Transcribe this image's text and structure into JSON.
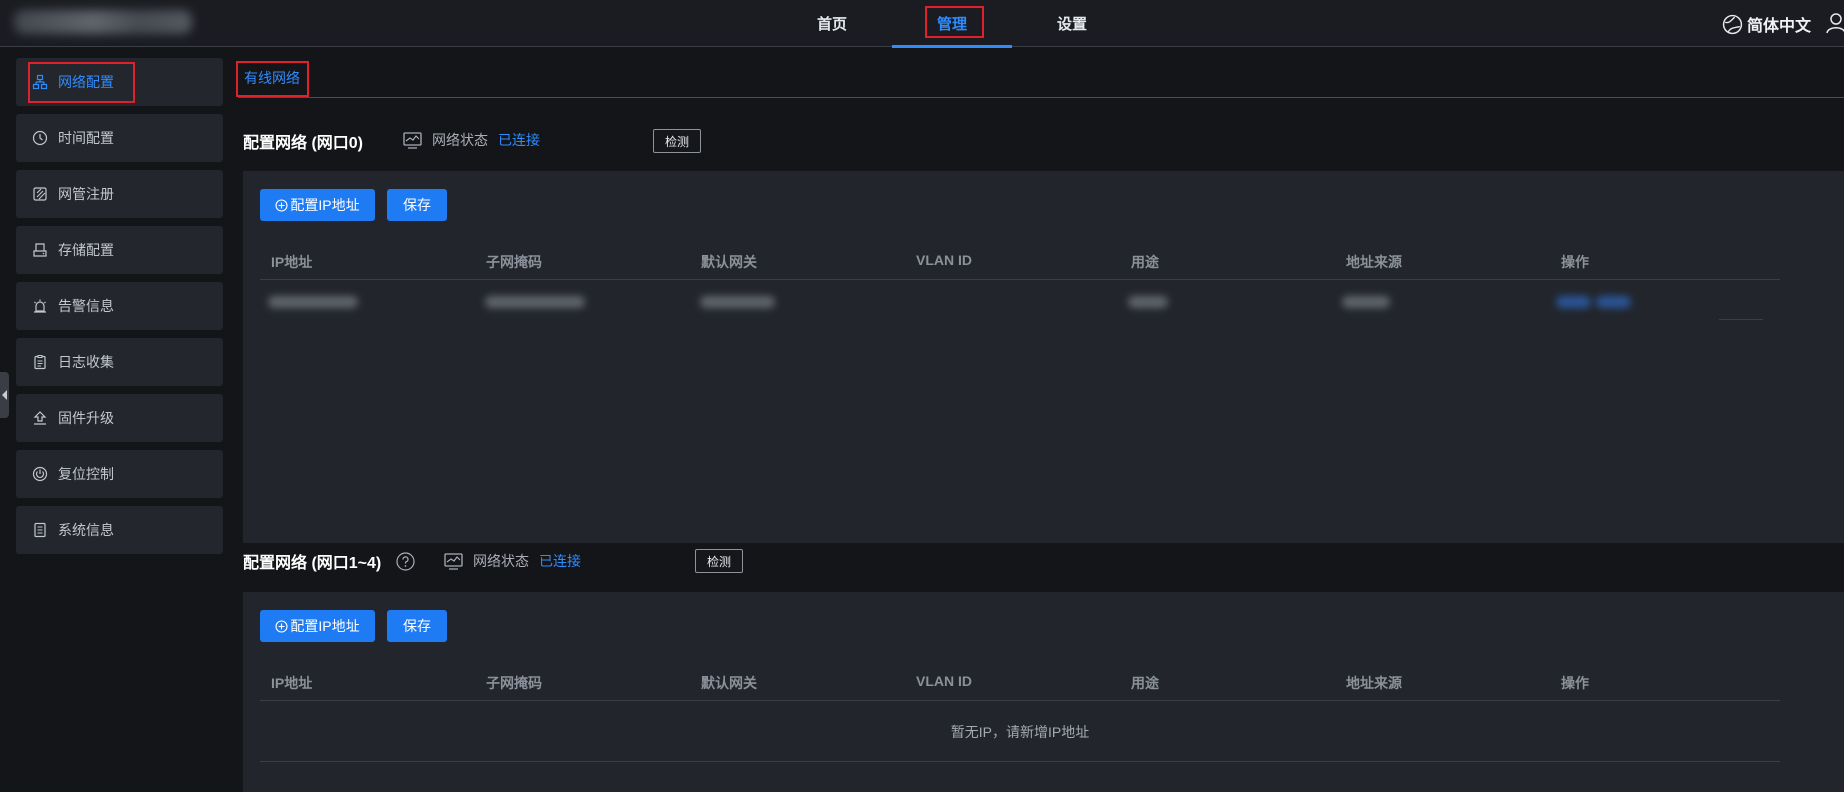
{
  "nav": {
    "home": "首页",
    "manage": "管理",
    "settings": "设置",
    "language": "简体中文"
  },
  "sidebar": {
    "items": [
      {
        "label": "网络配置",
        "icon": "network-icon",
        "active": true
      },
      {
        "label": "时间配置",
        "icon": "clock-icon"
      },
      {
        "label": "网管注册",
        "icon": "register-icon"
      },
      {
        "label": "存储配置",
        "icon": "storage-icon"
      },
      {
        "label": "告警信息",
        "icon": "alarm-icon"
      },
      {
        "label": "日志收集",
        "icon": "clipboard-icon"
      },
      {
        "label": "固件升级",
        "icon": "upgrade-icon"
      },
      {
        "label": "复位控制",
        "icon": "power-icon"
      },
      {
        "label": "系统信息",
        "icon": "document-icon"
      }
    ]
  },
  "tabs": {
    "wired": "有线网络"
  },
  "section0": {
    "title": "配置网络 (网口0)",
    "status_label": "网络状态",
    "status_value": "已连接",
    "detect": "检测",
    "add_ip": "配置IP地址",
    "save": "保存"
  },
  "section1": {
    "title": "配置网络 (网口1~4)",
    "status_label": "网络状态",
    "status_value": "已连接",
    "detect": "检测",
    "add_ip": "配置IP地址",
    "save": "保存",
    "empty": "暂无IP，请新增IP地址"
  },
  "table": {
    "columns": [
      "IP地址",
      "子网掩码",
      "默认网关",
      "VLAN ID",
      "用途",
      "地址来源",
      "操作"
    ]
  },
  "colors": {
    "accent": "#2f8cff",
    "button": "#1f7bf3",
    "background": "#141518",
    "panel": "#22252b"
  }
}
